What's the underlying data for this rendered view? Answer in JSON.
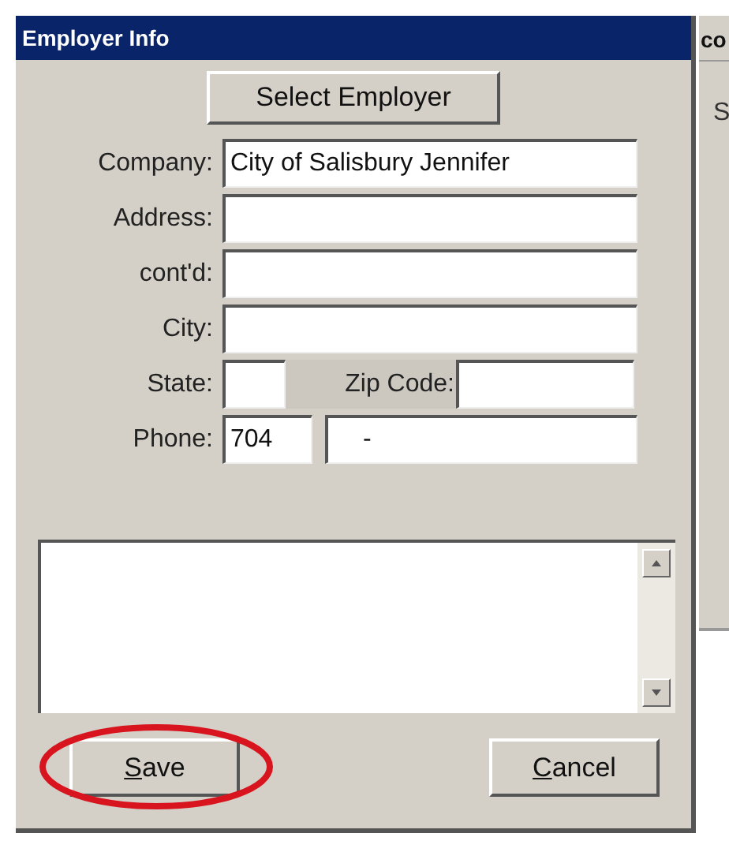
{
  "window": {
    "title": "Employer Info"
  },
  "select_button": {
    "label": "Select Employer"
  },
  "fields": [
    {
      "kind": "full",
      "label": "Company:",
      "value": "City of Salisbury Jennifer"
    },
    {
      "kind": "full",
      "label": "Address:"
    },
    {
      "kind": "full",
      "label": "cont'd:"
    },
    {
      "kind": "full",
      "label": "City:"
    },
    {
      "kind": "state_zip",
      "label": "State:",
      "second_label": "Zip Code:"
    },
    {
      "kind": "phone",
      "label": "Phone:",
      "value": "704",
      "second_value": "-"
    }
  ],
  "buttons": [
    {
      "label": "Save",
      "mnemonic_underlined": true,
      "highlighted": true
    },
    {
      "label": "Cancel",
      "mnemonic_underlined": true,
      "highlighted": false
    }
  ],
  "background_window": {
    "title": "co",
    "text": "S"
  }
}
